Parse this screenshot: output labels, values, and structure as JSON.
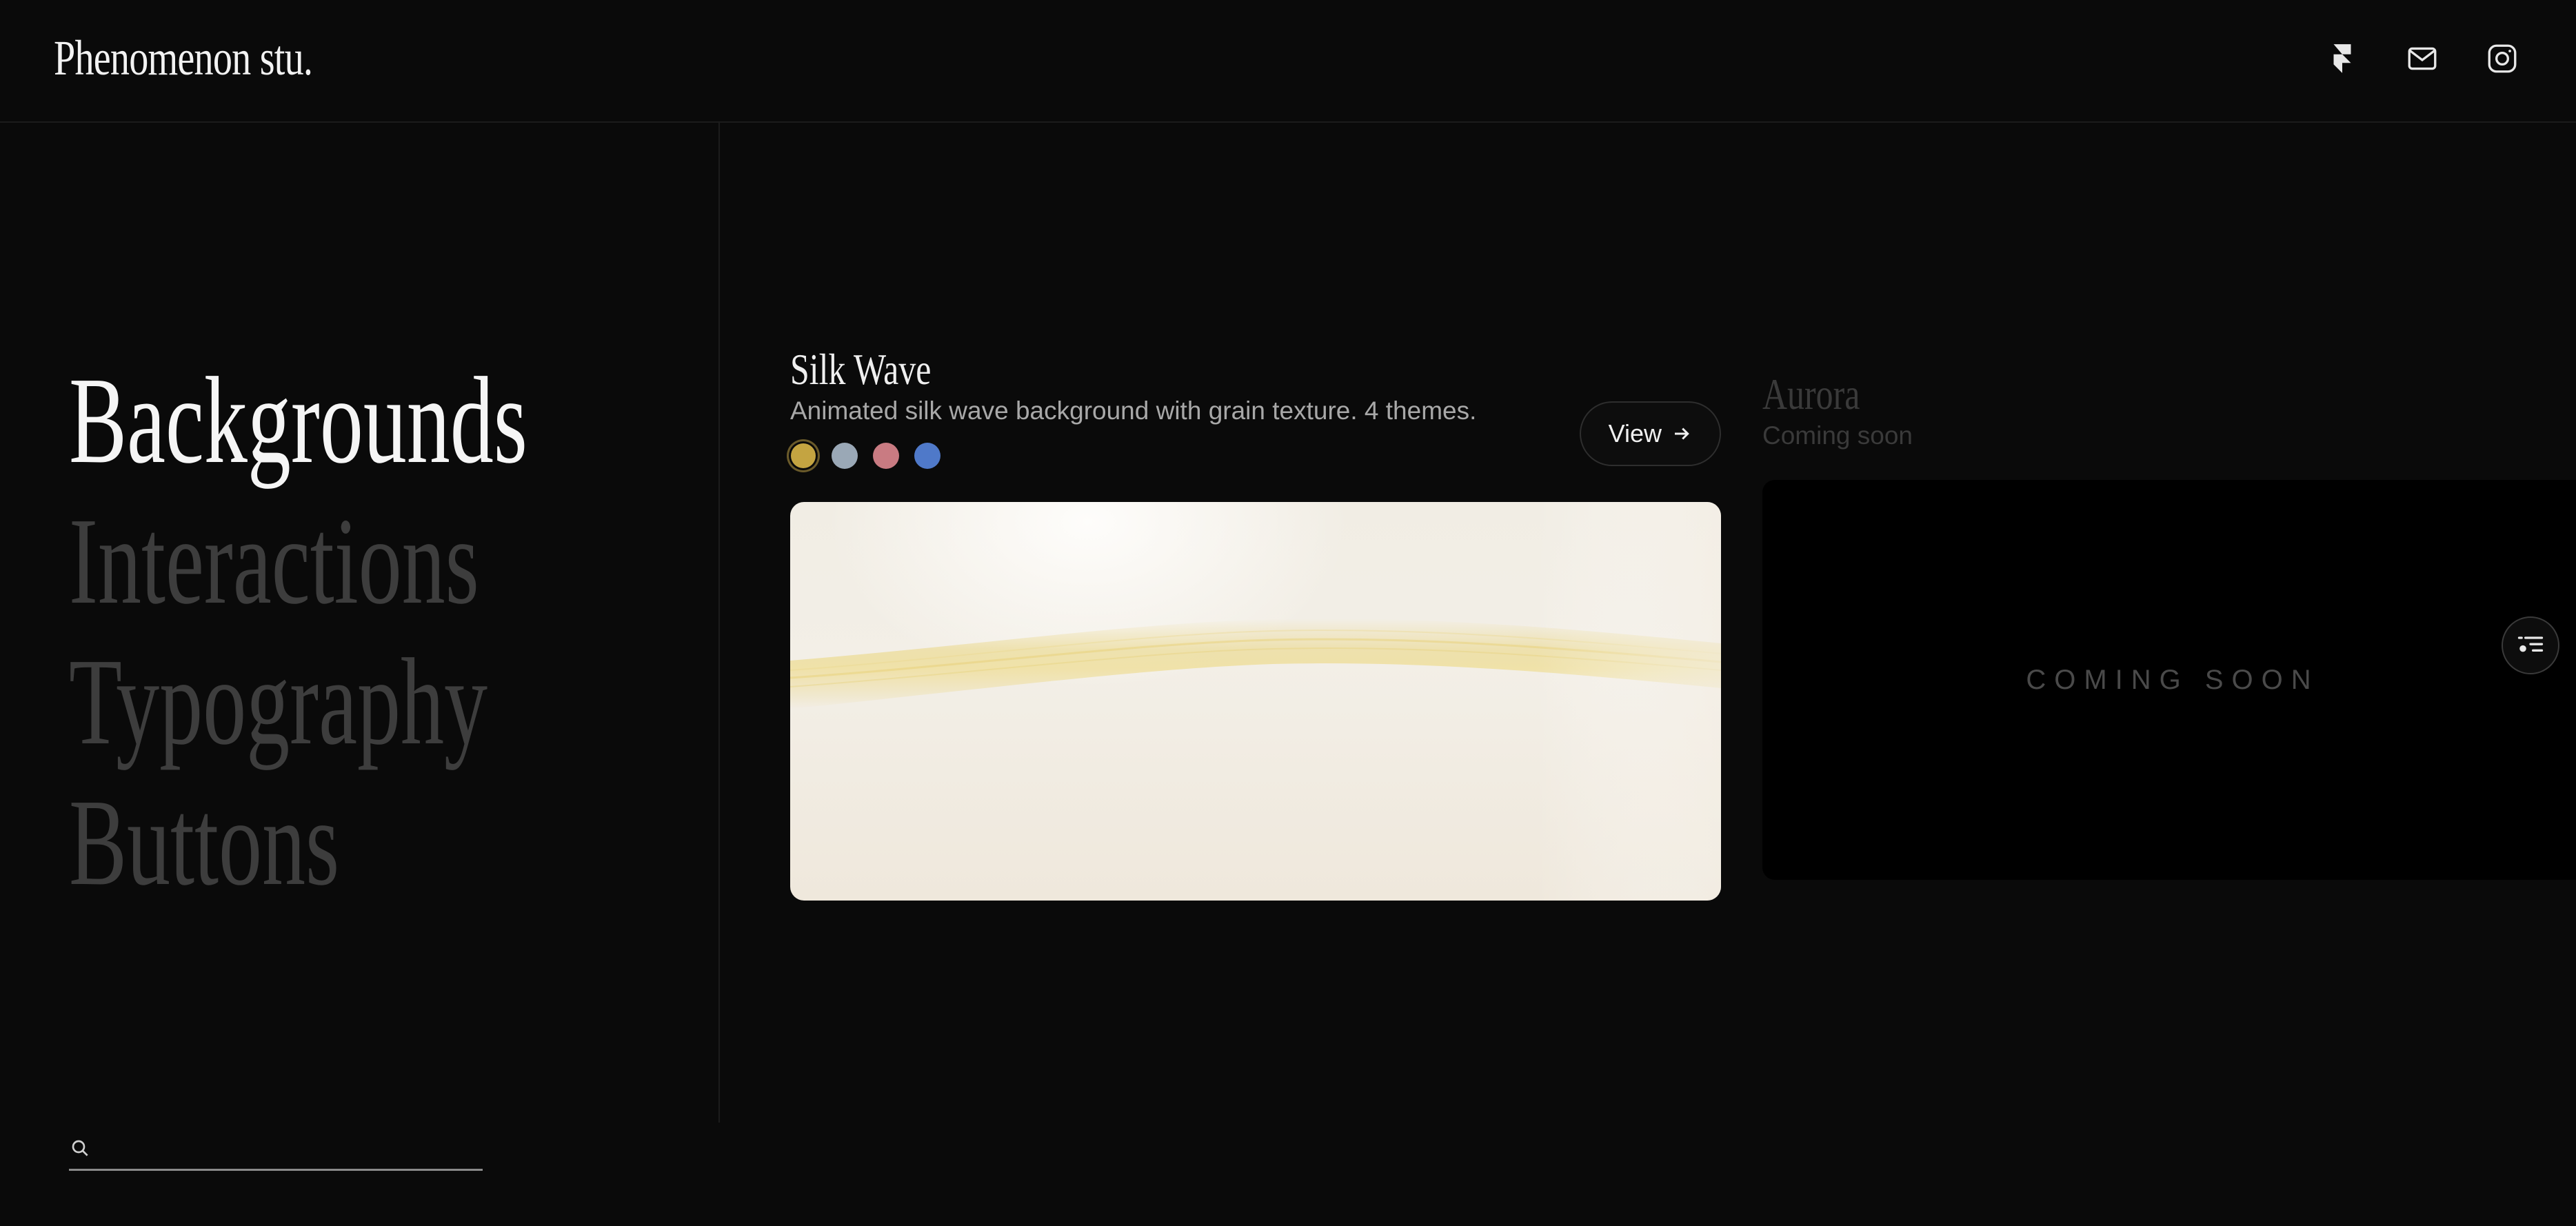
{
  "header": {
    "logo_text": "Phenomenon stu.",
    "icons": [
      "framer-icon",
      "mail-icon",
      "instagram-icon"
    ]
  },
  "sidebar": {
    "nav": [
      {
        "label": "Backgrounds",
        "active": true
      },
      {
        "label": "Interactions",
        "active": false
      },
      {
        "label": "Typography",
        "active": false
      },
      {
        "label": "Buttons",
        "active": false
      }
    ],
    "search": {
      "value": "",
      "placeholder": ""
    }
  },
  "cards": [
    {
      "title": "Silk Wave",
      "description": "Animated silk wave background with grain texture. 4 themes.",
      "swatches": [
        "#c4a441",
        "#9aa8b6",
        "#c97b82",
        "#4f79c9"
      ],
      "selected_swatch": 0,
      "view_label": "View"
    },
    {
      "title": "Aurora",
      "description": "Coming soon",
      "preview_label": "COMING SOON"
    }
  ],
  "colors": {
    "background": "#0a0a0a",
    "text_active": "#f5f5f5",
    "text_muted": "#3d3d3d",
    "silk_highlight": "#e8d27a"
  }
}
